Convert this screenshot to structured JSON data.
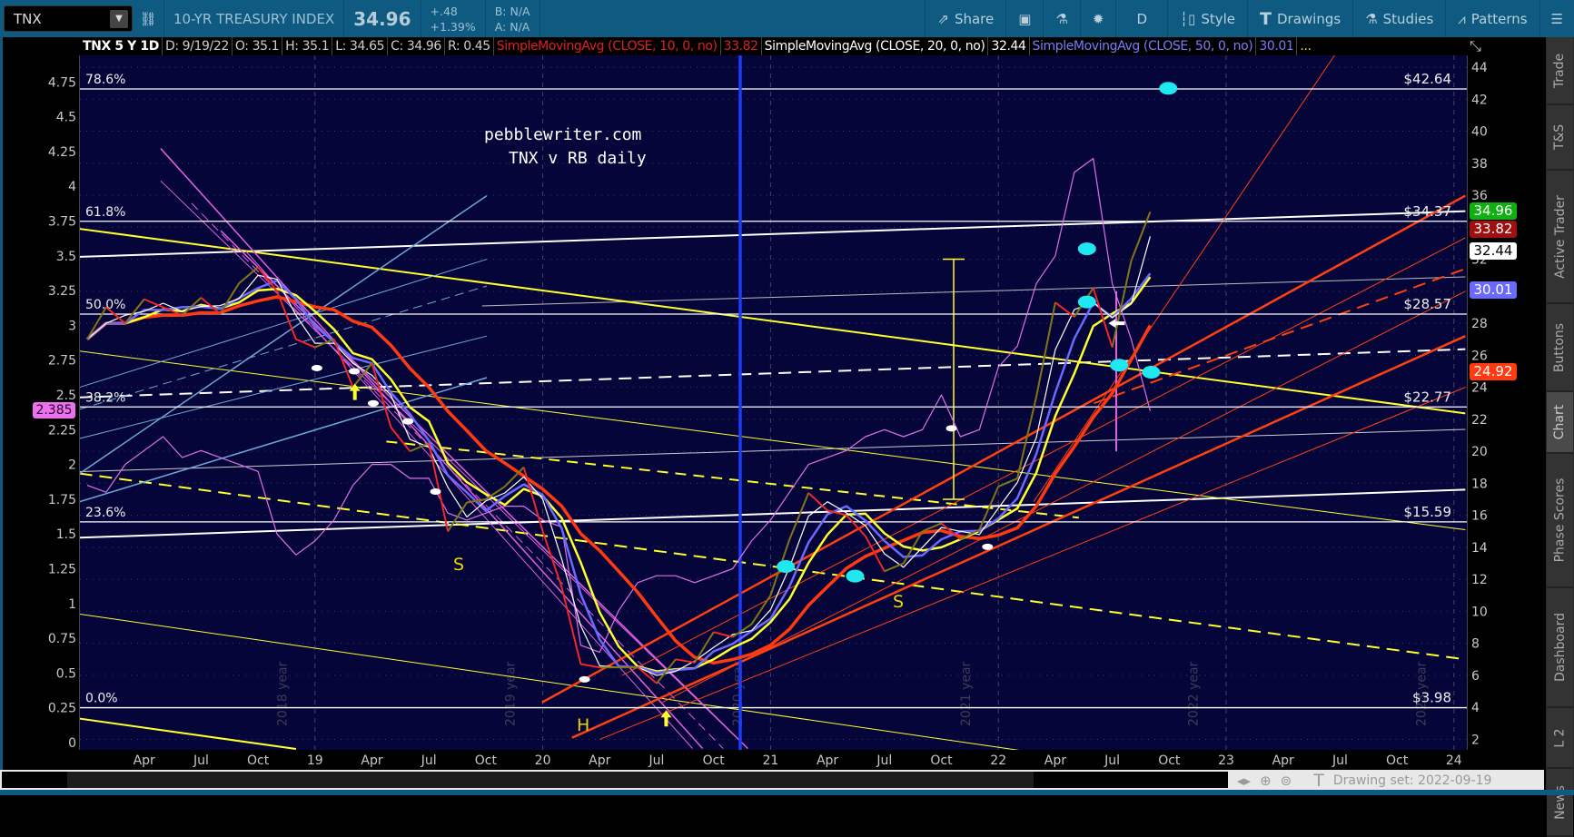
{
  "toolbar": {
    "symbol": "TNX",
    "title": "10-YR TREASURY INDEX",
    "last": "34.96",
    "change": "+.48",
    "change_pct": "+1.39%",
    "bid": "B: N/A",
    "ask": "A: N/A",
    "buttons": {
      "share": "Share",
      "period": "D",
      "style": "Style",
      "drawings": "Drawings",
      "studies": "Studies",
      "patterns": "Patterns"
    }
  },
  "legend": {
    "symbol": "TNX 5 Y 1D",
    "date": "D: 9/19/22",
    "open": "O: 35.1",
    "high": "H: 35.1",
    "low": "L: 34.65",
    "close": "C: 34.96",
    "range": "R: 0.45",
    "sma10": "SimpleMovingAvg (CLOSE, 10, 0, no)",
    "sma10_val": "33.82",
    "sma20": "SimpleMovingAvg (CLOSE, 20, 0, no)",
    "sma20_val": "32.44",
    "sma50": "SimpleMovingAvg (CLOSE, 50, 0, no)",
    "sma50_val": "30.01",
    "more": "..."
  },
  "annotations": {
    "site": "pebblewriter.com",
    "subtitle": "TNX v RB daily",
    "s1": "S",
    "h": "H",
    "s2": "S"
  },
  "price_labels": {
    "last": "34.96",
    "sma10": "33.82",
    "sma20": "32.44",
    "sma50": "30.01",
    "long_ma": "24.92",
    "rb": "2.385"
  },
  "colors": {
    "bg": "#05053a",
    "up": "#00c800",
    "down": "#e02020",
    "sma10": "#ff2a2a",
    "sma20": "#ffffff",
    "sma50": "#6a6aff",
    "yellow": "#ffff30",
    "rb": "#e070e8",
    "vline": "#1a3cff"
  },
  "bottom": {
    "drawing_set": "Drawing set: 2022-09-19"
  },
  "tabs": [
    "Trade",
    "T&S",
    "Active Trader",
    "Buttons",
    "Chart",
    "Phase Scores",
    "Dashboard",
    "L 2",
    "News"
  ],
  "chart_data": {
    "type": "line",
    "title": "TNX 5 Y 1D",
    "x_unit": "month",
    "x_start": "2018-01",
    "x_ticks": [
      "Apr",
      "Jul",
      "Oct",
      "19",
      "Apr",
      "Jul",
      "Oct",
      "20",
      "Apr",
      "Jul",
      "Oct",
      "21",
      "Apr",
      "Jul",
      "Oct",
      "22",
      "Apr",
      "Jul",
      "Oct",
      "23",
      "Apr",
      "Jul",
      "Oct",
      "24"
    ],
    "year_watermarks": [
      "2018 year",
      "2019 year",
      "2020 year",
      "2021 year",
      "2022 year",
      "2023 year"
    ],
    "right_axis": {
      "ticks": [
        2,
        4,
        6,
        8,
        10,
        12,
        14,
        16,
        18,
        20,
        22,
        24,
        26,
        28,
        30,
        32,
        34,
        36,
        38,
        40,
        42,
        44
      ],
      "ylim": [
        1,
        45
      ]
    },
    "left_axis": {
      "ticks": [
        "0",
        "0.25",
        "0.5",
        "0.75",
        "1",
        "1.25",
        "1.5",
        "1.75",
        "2",
        "2.25",
        "2.5",
        "2.75",
        "3",
        "3.25",
        "3.5",
        "3.75",
        "4",
        "4.25",
        "4.5",
        "4.75"
      ],
      "ylim": [
        0,
        4.8
      ]
    },
    "series": [
      {
        "name": "TNX",
        "axis": "right",
        "values": [
          27,
          29,
          28,
          29.5,
          29,
          28.5,
          29.6,
          28.6,
          30.5,
          31.5,
          30,
          27,
          26.5,
          27,
          24,
          25.5,
          21.5,
          20,
          20.5,
          15,
          16.8,
          17,
          17.8,
          19,
          15,
          11.5,
          6.7,
          6.5,
          6.5,
          6.5,
          5.5,
          7,
          6.8,
          8.7,
          8.4,
          9.2,
          11,
          14.5,
          17.4,
          16.3,
          16,
          14.7,
          12.5,
          13,
          15,
          15.5,
          14.5,
          15.1,
          17.8,
          18.3,
          23.4,
          29.3,
          28.4,
          30.2,
          26.5,
          31.9,
          34.96
        ]
      },
      {
        "name": "RB",
        "axis": "left",
        "values": [
          1.85,
          1.8,
          2.0,
          2.1,
          2.2,
          2.05,
          2.1,
          2.05,
          2.0,
          1.95,
          1.5,
          1.35,
          1.45,
          1.6,
          1.85,
          2.0,
          2.0,
          1.9,
          1.9,
          1.65,
          1.6,
          1.65,
          1.7,
          1.7,
          1.6,
          1.55,
          0.7,
          0.65,
          0.95,
          1.15,
          1.2,
          1.2,
          1.15,
          1.2,
          1.25,
          1.45,
          1.6,
          1.8,
          2.0,
          2.05,
          2.1,
          2.2,
          2.25,
          2.2,
          2.25,
          2.5,
          2.2,
          2.25,
          2.7,
          2.85,
          3.3,
          3.5,
          4.1,
          4.2,
          3.3,
          2.9,
          2.385
        ]
      }
    ],
    "fib_levels": [
      {
        "pct": "78.6%",
        "value": 42.64,
        "label": "$42.64"
      },
      {
        "pct": "61.8%",
        "value": 34.37,
        "label": "$34.37"
      },
      {
        "pct": "50.0%",
        "value": 28.57,
        "label": "$28.57"
      },
      {
        "pct": "38.2%",
        "value": 22.77,
        "label": "$22.77"
      },
      {
        "pct": "23.6%",
        "value": 15.59,
        "label": "$15.59"
      },
      {
        "pct": "0.0%",
        "value": 3.98,
        "label": "$3.98"
      }
    ]
  }
}
